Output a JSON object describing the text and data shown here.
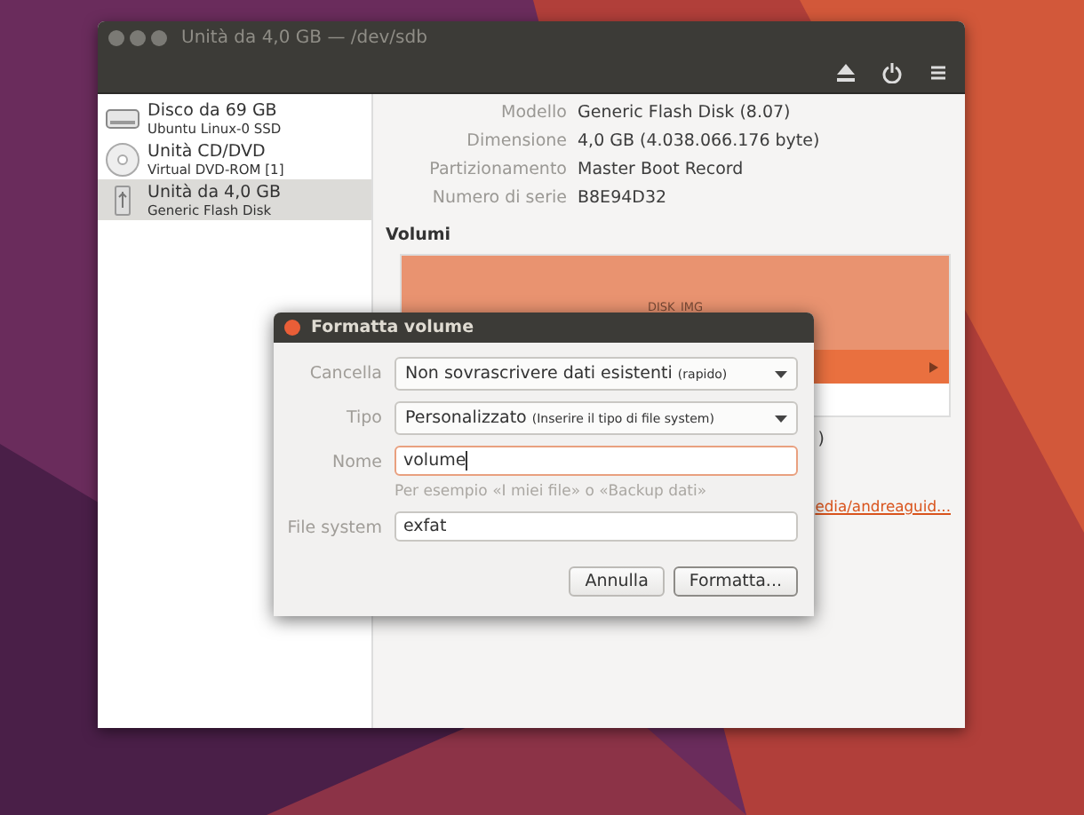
{
  "window": {
    "title": "Unità da 4,0 GB — /dev/sdb"
  },
  "sidebar": {
    "items": [
      {
        "title": "Disco da 69 GB",
        "subtitle": "Ubuntu Linux-0 SSD",
        "kind": "disk",
        "selected": false
      },
      {
        "title": "Unità CD/DVD",
        "subtitle": "Virtual DVD-ROM [1]",
        "kind": "optical",
        "selected": false
      },
      {
        "title": "Unità da 4,0 GB",
        "subtitle": "Generic Flash Disk",
        "kind": "usb",
        "selected": true
      }
    ]
  },
  "details": [
    {
      "label": "Modello",
      "value": "Generic Flash Disk (8.07)"
    },
    {
      "label": "Dimensione",
      "value": "4,0 GB (4.038.066.176 byte)"
    },
    {
      "label": "Partizionamento",
      "value": "Master Boot Record"
    },
    {
      "label": "Numero di serie",
      "value": "B8E94D32"
    }
  ],
  "volumes": {
    "heading": "Volumi",
    "label": "DISK_IMG",
    "fragment": ")",
    "link": "edia/andreaguid..."
  },
  "dialog": {
    "title": "Formatta volume",
    "fields": [
      {
        "label": "Cancella",
        "kind": "combo",
        "value": "Non sovrascrivere dati esistenti",
        "note": "(rapido)"
      },
      {
        "label": "Tipo",
        "kind": "combo",
        "value": "Personalizzato",
        "note": "(Inserire il tipo di file system)"
      },
      {
        "label": "Nome",
        "kind": "entry",
        "value": "volume",
        "focused": true,
        "hint": "Per esempio «I miei file» o «Backup dati»"
      },
      {
        "label": "File system",
        "kind": "entry",
        "value": "exfat",
        "focused": false
      }
    ],
    "buttons": [
      "Annulla",
      "Formatta..."
    ]
  }
}
